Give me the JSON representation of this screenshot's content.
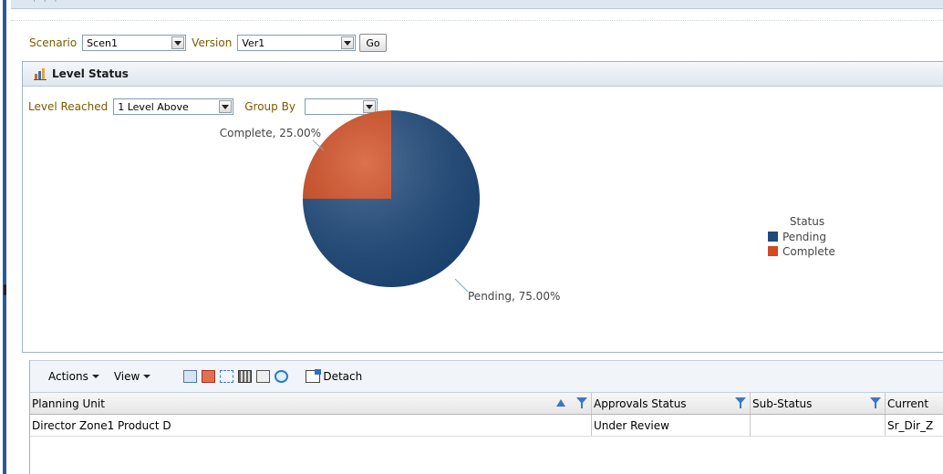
{
  "scenario": {
    "label": "Scenario",
    "value": "Scen1"
  },
  "version": {
    "label": "Version",
    "value": "Ver1"
  },
  "go_label": "Go",
  "panel": {
    "title": "Level Status",
    "icon": "bar-chart-icon"
  },
  "level_reached": {
    "label": "Level Reached",
    "value": "1 Level Above"
  },
  "group_by": {
    "label": "Group By",
    "value": ""
  },
  "chart_data": {
    "type": "pie",
    "slices": [
      {
        "name": "Pending",
        "value": 75.0,
        "label": "Pending, 75.00%",
        "color": "#1e4a7c"
      },
      {
        "name": "Complete",
        "value": 25.0,
        "label": "Complete, 25.00%",
        "color": "#d24a1e"
      }
    ],
    "legend": {
      "title": "Status",
      "entries": [
        "Pending",
        "Complete"
      ],
      "position": "right"
    }
  },
  "toolbar": {
    "actions_label": "Actions",
    "view_label": "View",
    "icons": [
      "query-icon",
      "remove-filter-icon",
      "hierarchy-icon",
      "columns-icon",
      "detach-small-icon",
      "refresh-icon"
    ],
    "detach_label": "Detach"
  },
  "table": {
    "columns": [
      "Planning Unit",
      "Approvals Status",
      "Sub-Status",
      "Current"
    ],
    "rows": [
      [
        "Director Zone1 Product D",
        "Under Review",
        "",
        "Sr_Dir_Z"
      ]
    ]
  },
  "colors": {
    "accent": "#2a5a9c",
    "label": "#7a5a00"
  }
}
